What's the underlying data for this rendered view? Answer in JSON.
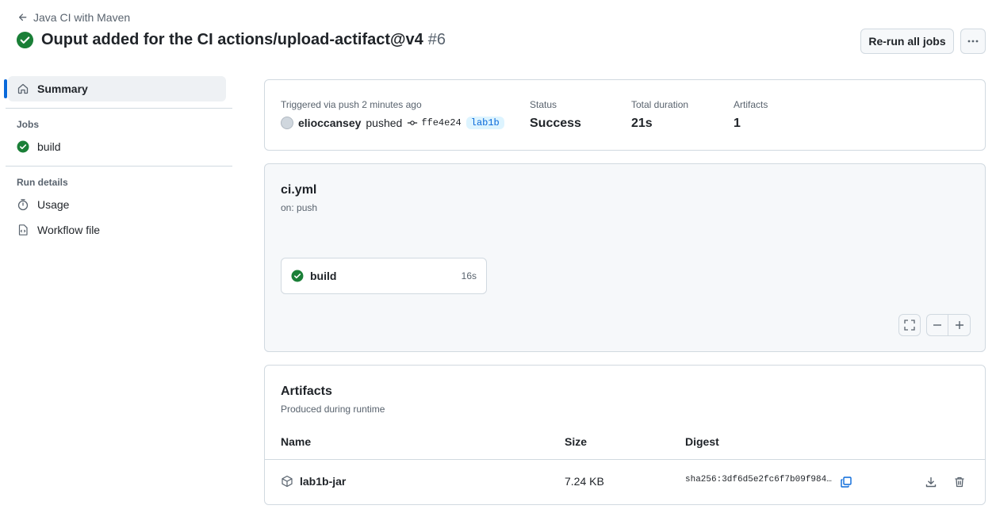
{
  "header": {
    "back_label": "Java CI with Maven",
    "title": "Ouput added for the CI actions/upload-actifact@v4",
    "run_number": "#6",
    "rerun_label": "Re-run all jobs",
    "status_color": "#1a7f37"
  },
  "sidebar": {
    "summary_label": "Summary",
    "jobs_heading": "Jobs",
    "jobs": [
      {
        "label": "build",
        "status": "success"
      }
    ],
    "run_details_heading": "Run details",
    "usage_label": "Usage",
    "workflow_file_label": "Workflow file"
  },
  "summary": {
    "trigger_text": "Triggered via push 2 minutes ago",
    "actor": "elioccansey",
    "action": "pushed",
    "commit": "ffe4e24",
    "branch": "lab1b",
    "status_label": "Status",
    "status_value": "Success",
    "duration_label": "Total duration",
    "duration_value": "21s",
    "artifacts_label": "Artifacts",
    "artifacts_value": "1"
  },
  "workflow": {
    "file": "ci.yml",
    "trigger": "on: push",
    "job_name": "build",
    "job_duration": "16s"
  },
  "artifacts": {
    "title": "Artifacts",
    "subtitle": "Produced during runtime",
    "columns": [
      "Name",
      "Size",
      "Digest"
    ],
    "rows": [
      {
        "name": "lab1b-jar",
        "size": "7.24 KB",
        "digest": "sha256:3df6d5e2fc6f7b09f984…"
      }
    ]
  },
  "colors": {
    "accent": "#0969da",
    "success": "#1a7f37",
    "muted": "#59636e"
  }
}
